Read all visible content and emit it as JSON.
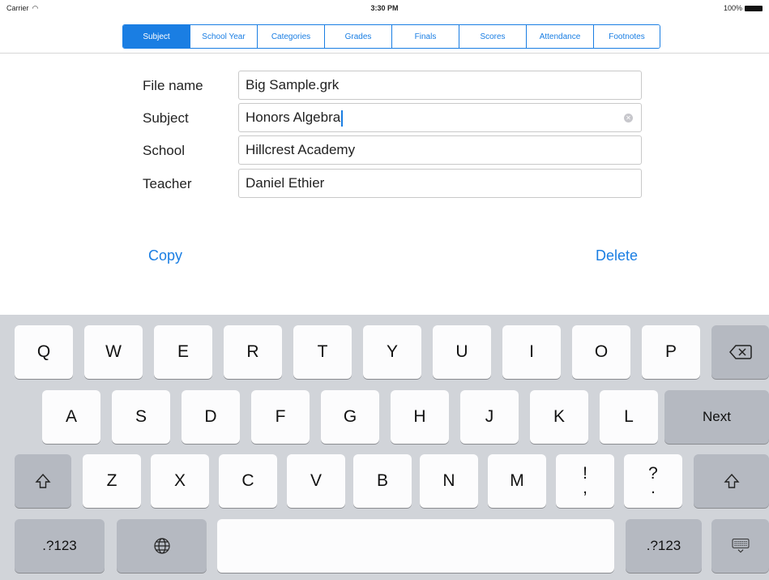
{
  "status_bar": {
    "carrier": "Carrier",
    "time": "3:30 PM",
    "battery": "100%"
  },
  "tabs": [
    {
      "label": "Subject",
      "active": true
    },
    {
      "label": "School Year",
      "active": false
    },
    {
      "label": "Categories",
      "active": false
    },
    {
      "label": "Grades",
      "active": false
    },
    {
      "label": "Finals",
      "active": false
    },
    {
      "label": "Scores",
      "active": false
    },
    {
      "label": "Attendance",
      "active": false
    },
    {
      "label": "Footnotes",
      "active": false
    }
  ],
  "form": {
    "file_name_label": "File name",
    "file_name_value": "Big Sample.grk",
    "subject_label": "Subject",
    "subject_value": "Honors Algebra",
    "school_label": "School",
    "school_value": "Hillcrest Academy",
    "teacher_label": "Teacher",
    "teacher_value": "Daniel Ethier"
  },
  "actions": {
    "copy_label": "Copy",
    "delete_label": "Delete"
  },
  "keyboard": {
    "row1": [
      "Q",
      "W",
      "E",
      "R",
      "T",
      "Y",
      "U",
      "I",
      "O",
      "P"
    ],
    "row2": [
      "A",
      "S",
      "D",
      "F",
      "G",
      "H",
      "J",
      "K",
      "L"
    ],
    "row3": [
      "Z",
      "X",
      "C",
      "V",
      "B",
      "N",
      "M"
    ],
    "punct1_top": "!",
    "punct1_bottom": ",",
    "punct2_top": "?",
    "punct2_bottom": ".",
    "next_label": "Next",
    "numbers_label": ".?123",
    "icons": [
      "backspace-icon",
      "shift-icon",
      "globe-icon",
      "keyboard-dismiss-icon"
    ]
  },
  "colors": {
    "accent": "#1a7ee3",
    "keyboard_bg": "#d1d4d9",
    "key_light": "#fcfcfd",
    "key_dark": "#b5b9c1"
  }
}
